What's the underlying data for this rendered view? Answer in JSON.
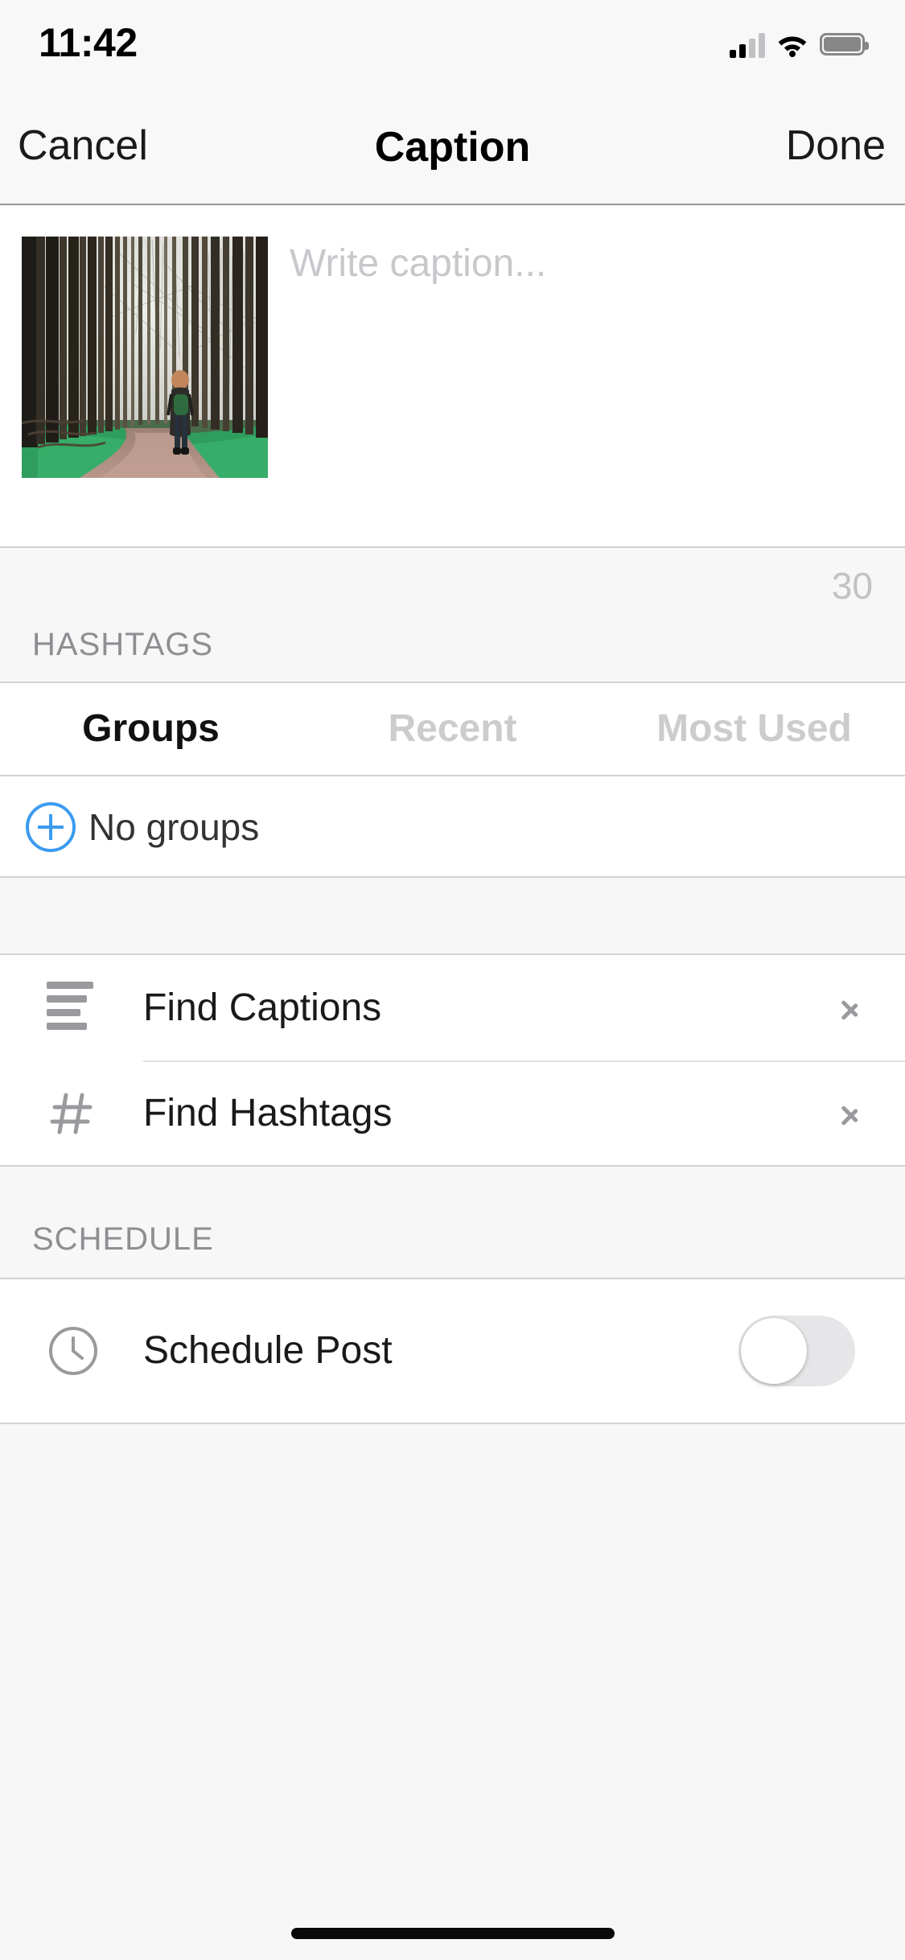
{
  "status_bar": {
    "time": "11:42",
    "cellular_icon": "cellular-signal-icon",
    "cellular_bars_filled": 2,
    "cellular_bars_total": 4,
    "wifi_icon": "wifi-icon",
    "battery_icon": "battery-full-icon"
  },
  "nav_bar": {
    "cancel_label": "Cancel",
    "title": "Caption",
    "done_label": "Done"
  },
  "caption": {
    "thumbnail_alt": "photo-thumbnail",
    "placeholder": "Write caption...",
    "value": "",
    "character_counter": "30"
  },
  "hashtags": {
    "section_label": "HASHTAGS",
    "tabs": [
      {
        "label": "Groups",
        "active": true
      },
      {
        "label": "Recent",
        "active": false
      },
      {
        "label": "Most Used",
        "active": false
      }
    ],
    "empty_row": {
      "icon": "plus-circle-icon",
      "label": "No groups"
    }
  },
  "menu": {
    "items": [
      {
        "icon": "text-lines-icon",
        "label": "Find Captions",
        "accessory": "chevron-right-icon"
      },
      {
        "icon": "hashtag-icon",
        "label": "Find Hashtags",
        "accessory": "chevron-right-icon"
      }
    ]
  },
  "schedule": {
    "section_label": "SCHEDULE",
    "row": {
      "icon": "clock-icon",
      "label": "Schedule Post",
      "toggle_on": false
    }
  },
  "colors": {
    "accent_blue": "#3C9BF0",
    "text_primary": "#1A1A1A",
    "text_secondary": "#8E8E93",
    "placeholder": "#C8C8CC",
    "group_bg": "#F7F7F7",
    "cell_bg": "#FFFFFF",
    "separator": "#D2D2D4",
    "toggle_off_track": "#E6E6E8"
  },
  "home_indicator": "home-indicator-bar"
}
